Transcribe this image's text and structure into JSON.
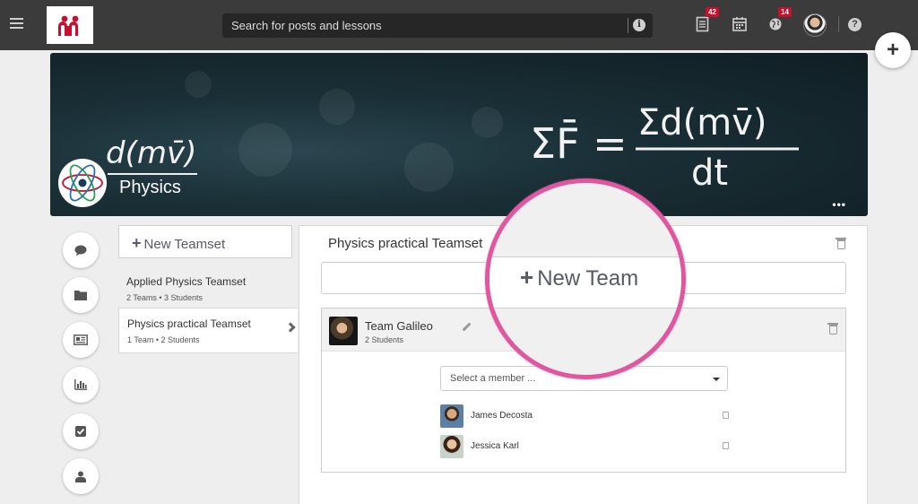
{
  "header": {
    "search_placeholder": "Search for posts and lessons",
    "notifications_badge": "42",
    "globe_badge": "14",
    "help_label": "?"
  },
  "banner": {
    "title": "Physics",
    "formula_large": "ΣF = Σd(mv)/dt",
    "more_label": "•••"
  },
  "rail": {
    "icons": [
      "comment-icon",
      "folder-icon",
      "newspaper-icon",
      "bar-chart-icon",
      "checkbox-icon",
      "user-icon"
    ]
  },
  "teamsets": {
    "new_label": "New Teamset",
    "items": [
      {
        "title": "Applied Physics Teamset",
        "meta": "2 Teams • 3 Students"
      },
      {
        "title": "Physics practical Teamset",
        "meta": "1 Team • 2 Students"
      }
    ]
  },
  "panel": {
    "title": "Physics practical Teamset",
    "new_team_label": "New Team",
    "team": {
      "name": "Team Galileo",
      "count": "2 Students"
    },
    "member_select_placeholder": "Select a member ...",
    "members": [
      {
        "name": "James Decosta"
      },
      {
        "name": "Jessica Karl"
      }
    ]
  },
  "colors": {
    "brand_red": "#c8102e",
    "highlight_pink": "#e0569f",
    "nav_bg": "#3b3b3b"
  }
}
